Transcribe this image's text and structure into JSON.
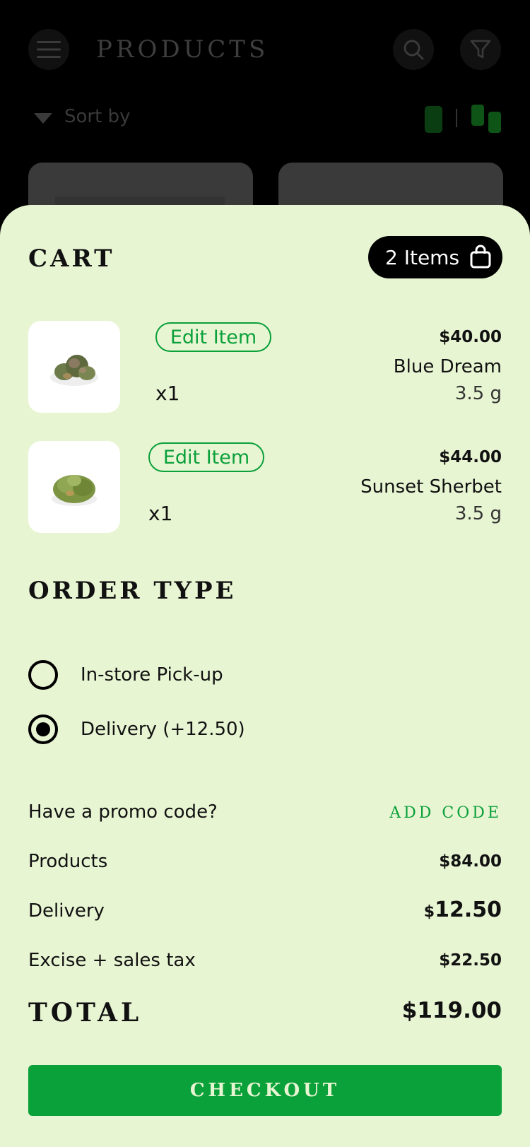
{
  "header": {
    "title": "PRODUCTS",
    "menu_icon": "hamburger-menu-icon",
    "search_icon": "search-icon",
    "filter_icon": "filter-icon"
  },
  "sort": {
    "label": "Sort by"
  },
  "cart": {
    "title": "CART",
    "items_count_label": "2 Items",
    "items": [
      {
        "edit_label": "Edit Item",
        "quantity": "x1",
        "price": "$40.00",
        "name": "Blue Dream",
        "weight": "3.5 g"
      },
      {
        "edit_label": "Edit Item",
        "quantity": "x1",
        "price": "$44.00",
        "name": "Sunset Sherbet",
        "weight": "3.5 g"
      }
    ]
  },
  "order_type": {
    "title": "ORDER TYPE",
    "options": [
      {
        "label": "In-store Pick-up",
        "selected": false
      },
      {
        "label": "Delivery (+12.50)",
        "selected": true
      }
    ]
  },
  "summary": {
    "promo_label": "Have a promo code?",
    "add_code_label": "ADD CODE",
    "products_label": "Products",
    "products_value": "$84.00",
    "delivery_label": "Delivery",
    "delivery_currency": "$",
    "delivery_value": "12.50",
    "tax_label": "Excise + sales tax",
    "tax_value": "$22.50",
    "total_label": "TOTAL",
    "total_value": "$119.00"
  },
  "checkout_label": "CHECKOUT",
  "colors": {
    "accent": "#0aa03a",
    "sheet_bg": "#e8f5d3",
    "badge_bg": "#000000"
  }
}
